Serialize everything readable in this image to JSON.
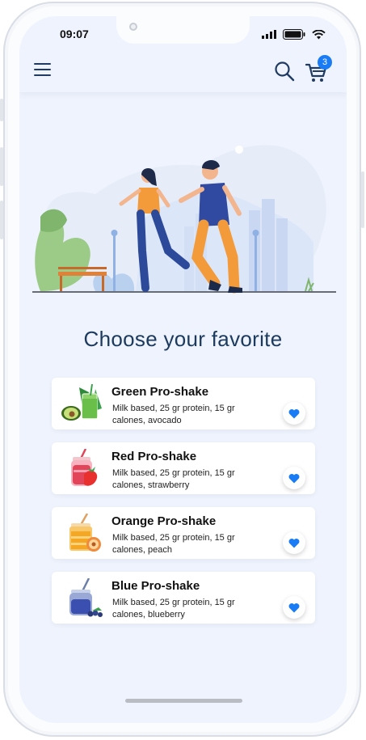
{
  "status_bar": {
    "time": "09:07"
  },
  "header": {
    "cart_count": "3",
    "icons": [
      "menu-icon",
      "search-icon",
      "cart-icon"
    ]
  },
  "main": {
    "title": "Choose your favorite"
  },
  "products": [
    {
      "name": "Green Pro-shake",
      "description": "Milk based, 25 gr protein, 15 gr calones, avocado",
      "color": "#6abf4b"
    },
    {
      "name": "Red Pro-shake",
      "description": "Milk based, 25 gr protein, 15 gr calones, strawberry",
      "color": "#e2455a"
    },
    {
      "name": "Orange Pro-shake",
      "description": "Milk based, 25 gr protein, 15 gr calones, peach",
      "color": "#f5a623"
    },
    {
      "name": "Blue Pro-shake",
      "description": "Milk based, 25 gr protein, 15 gr calones, blueberry",
      "color": "#3a4fb0"
    }
  ],
  "colors": {
    "accent": "#1a7cf5",
    "title": "#1b3a5e",
    "background": "#eff3fd"
  }
}
